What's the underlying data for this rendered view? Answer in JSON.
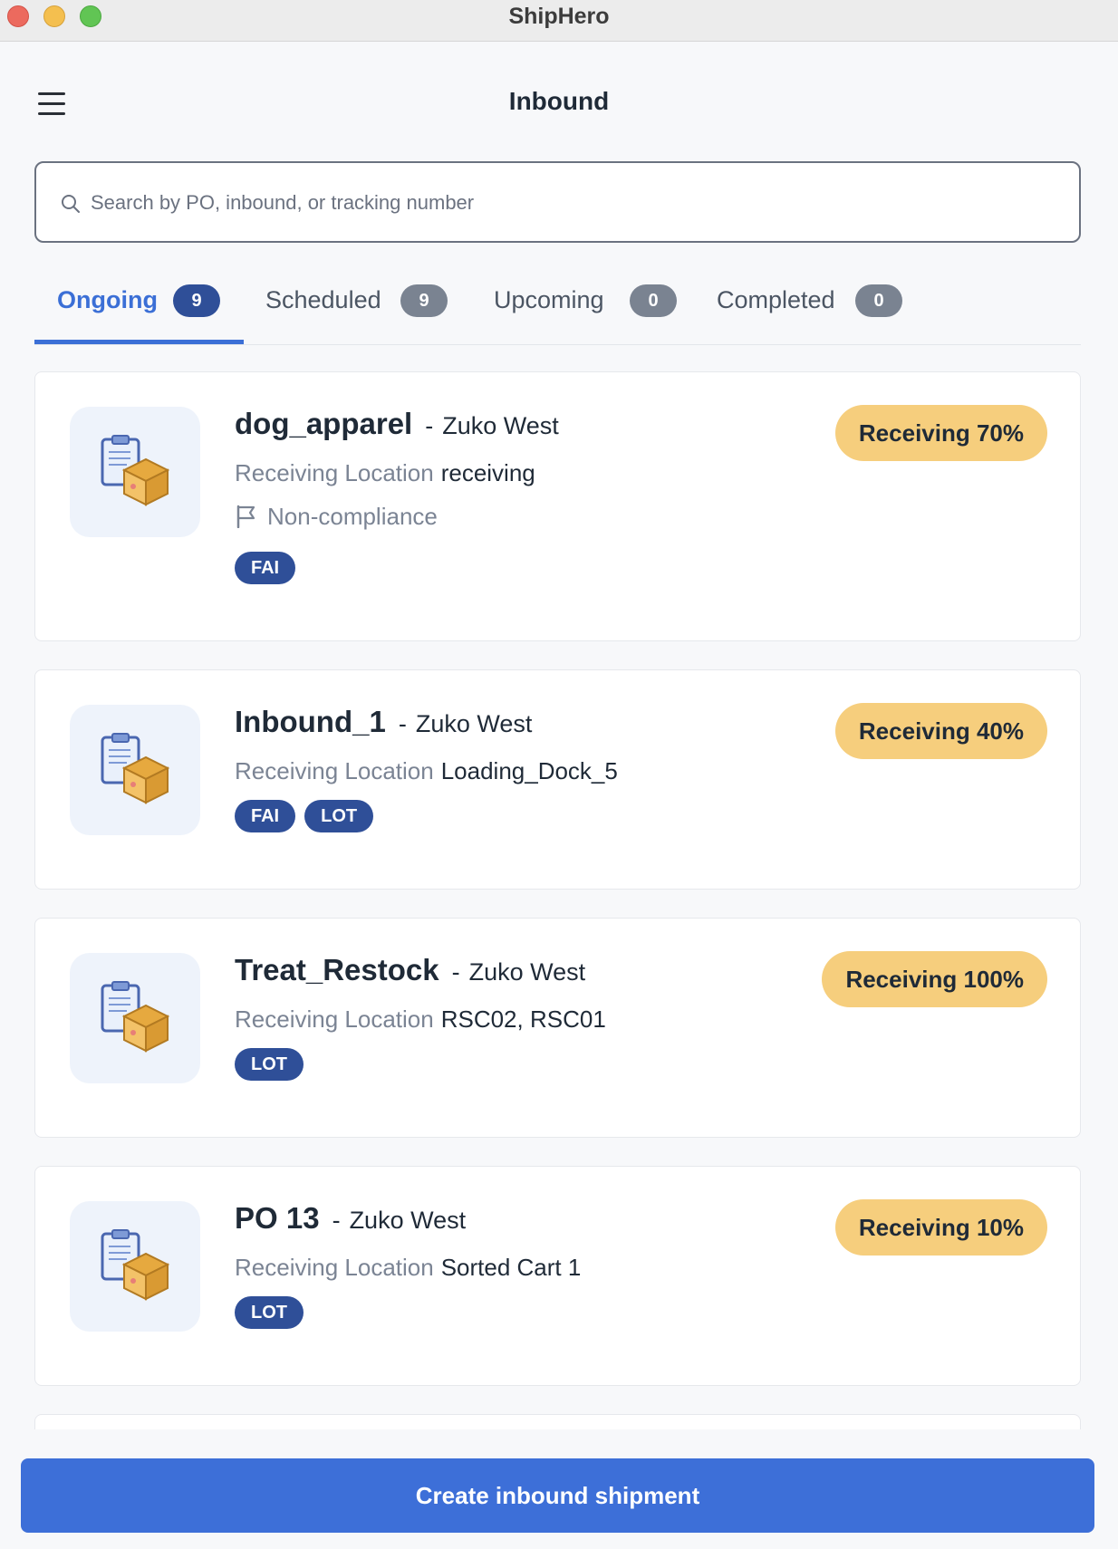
{
  "window": {
    "app_title": "ShipHero"
  },
  "header": {
    "title": "Inbound",
    "menu_icon": "hamburger-menu-icon"
  },
  "search": {
    "placeholder": "Search by PO, inbound, or tracking number",
    "value": ""
  },
  "tabs": [
    {
      "label": "Ongoing",
      "count": "9",
      "active": true
    },
    {
      "label": "Scheduled",
      "count": "9",
      "active": false
    },
    {
      "label": "Upcoming",
      "count": "0",
      "active": false
    },
    {
      "label": "Completed",
      "count": "0",
      "active": false
    }
  ],
  "location_label": "Receiving Location",
  "shipments": [
    {
      "name": "dog_apparel",
      "separator": "-",
      "warehouse": "Zuko West",
      "location": "receiving",
      "flag": "Non-compliance",
      "badges": [
        "FAI"
      ],
      "status": "Receiving 70%",
      "progress": 0.7
    },
    {
      "name": "Inbound_1",
      "separator": "-",
      "warehouse": "Zuko West",
      "location": "Loading_Dock_5",
      "badges": [
        "FAI",
        "LOT"
      ],
      "status": "Receiving 40%",
      "progress": 0.4
    },
    {
      "name": "Treat_Restock",
      "separator": "-",
      "warehouse": "Zuko West",
      "location": "RSC02, RSC01",
      "badges": [
        "LOT"
      ],
      "status": "Receiving 100%",
      "progress": 1.0
    },
    {
      "name": "PO 13",
      "separator": "-",
      "warehouse": "Zuko West",
      "location": "Sorted Cart 1",
      "badges": [
        "LOT"
      ],
      "status": "Receiving 10%",
      "progress": 0.1
    }
  ],
  "footer": {
    "create_label": "Create inbound shipment"
  },
  "colors": {
    "accent": "#3d6fd8",
    "badge": "#2f4f98",
    "status_pill": "#f6ce7d"
  }
}
